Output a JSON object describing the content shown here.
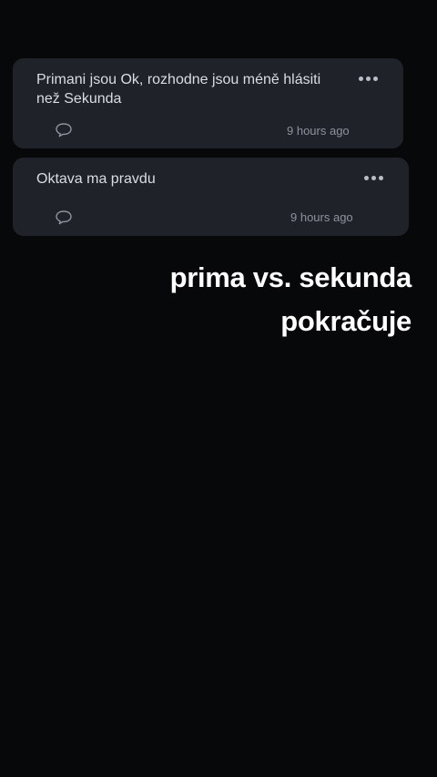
{
  "comments": [
    {
      "text": "Primani jsou Ok, rozhodne jsou méně hlásiti než Sekunda",
      "timestamp": "9 hours ago",
      "more_icon": "more-horizontal-icon",
      "reply_icon": "comment-bubble-icon"
    },
    {
      "text": "Oktava ma pravdu",
      "timestamp": "9 hours ago",
      "more_icon": "more-horizontal-icon",
      "reply_icon": "comment-bubble-icon"
    }
  ],
  "caption": {
    "line1": "prima vs. sekunda",
    "line2": "pokračuje"
  },
  "colors": {
    "background": "#07080a",
    "card": "#1f2229",
    "text": "#d9dde4",
    "muted": "#8d929c",
    "caption": "#ffffff"
  }
}
